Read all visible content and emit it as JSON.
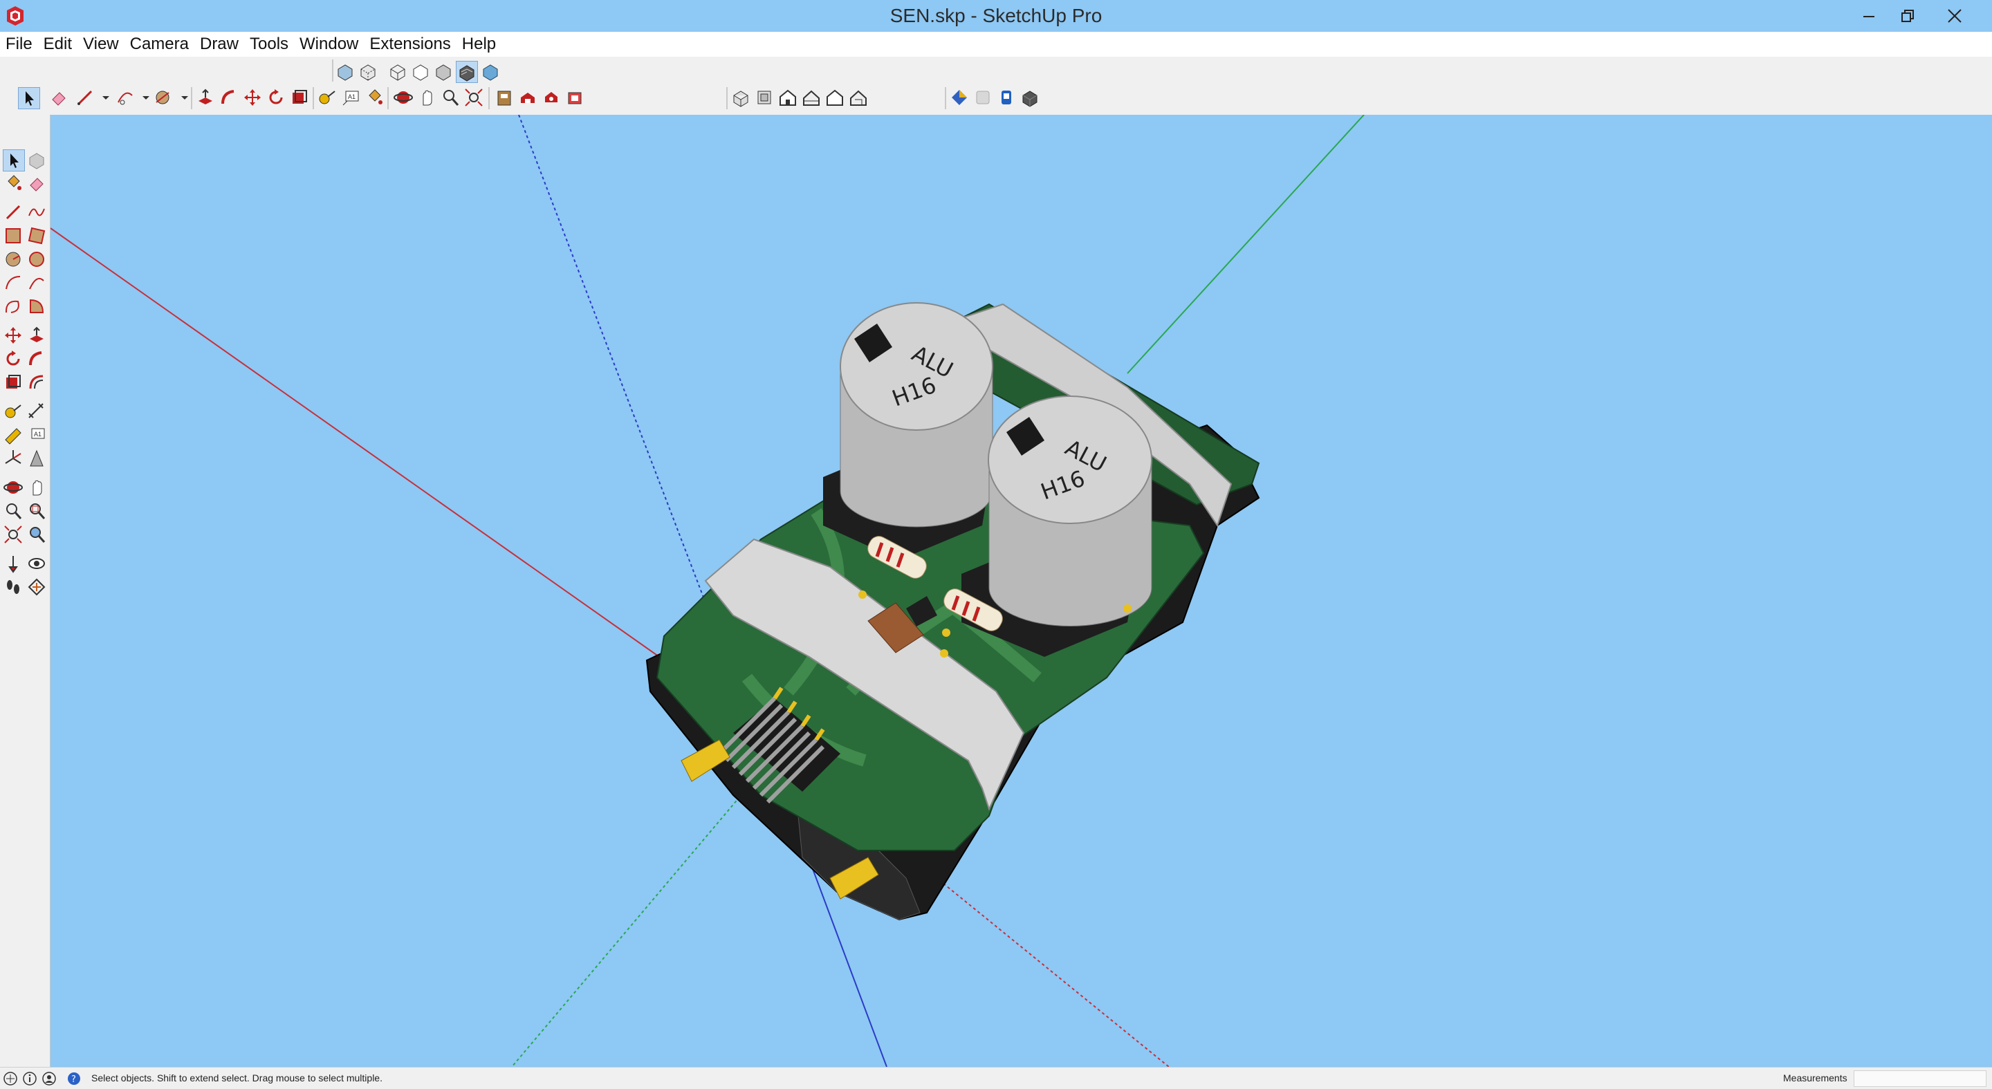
{
  "window": {
    "title": "SEN.skp - SketchUp Pro",
    "controls": [
      "minimize",
      "restore",
      "close"
    ]
  },
  "menu": {
    "items": [
      "File",
      "Edit",
      "View",
      "Camera",
      "Draw",
      "Tools",
      "Window",
      "Extensions",
      "Help"
    ]
  },
  "toolbar": {
    "views": [
      "iso-view-icon",
      "top-view-icon",
      "front-view-icon",
      "right-view-icon",
      "back-view-icon",
      "left-view-icon"
    ],
    "styles": [
      "xray-icon",
      "back-edges-icon",
      "wireframe-icon",
      "hidden-line-icon",
      "shaded-icon",
      "shaded-textures-icon",
      "monochrome-icon"
    ],
    "active_style": "shaded-textures-icon"
  },
  "model": {
    "capacitor_1_text": [
      "ALU",
      "H16"
    ],
    "capacitor_2_text": [
      "ALU",
      "H16"
    ]
  },
  "status": {
    "text": "Select objects. Shift to extend select. Drag mouse to select multiple.",
    "measurements_label": "Measurements",
    "measurements_value": ""
  },
  "colors": {
    "sky": "#8ec8f4",
    "pcb": "#2a6b3a",
    "pcb_trace": "#3f8a4c",
    "capacitor": "#c9c9c9",
    "gold": "#e8c020",
    "axis_red": "#c8303a",
    "axis_green": "#2aa850",
    "axis_blue": "#2a3cc8"
  }
}
